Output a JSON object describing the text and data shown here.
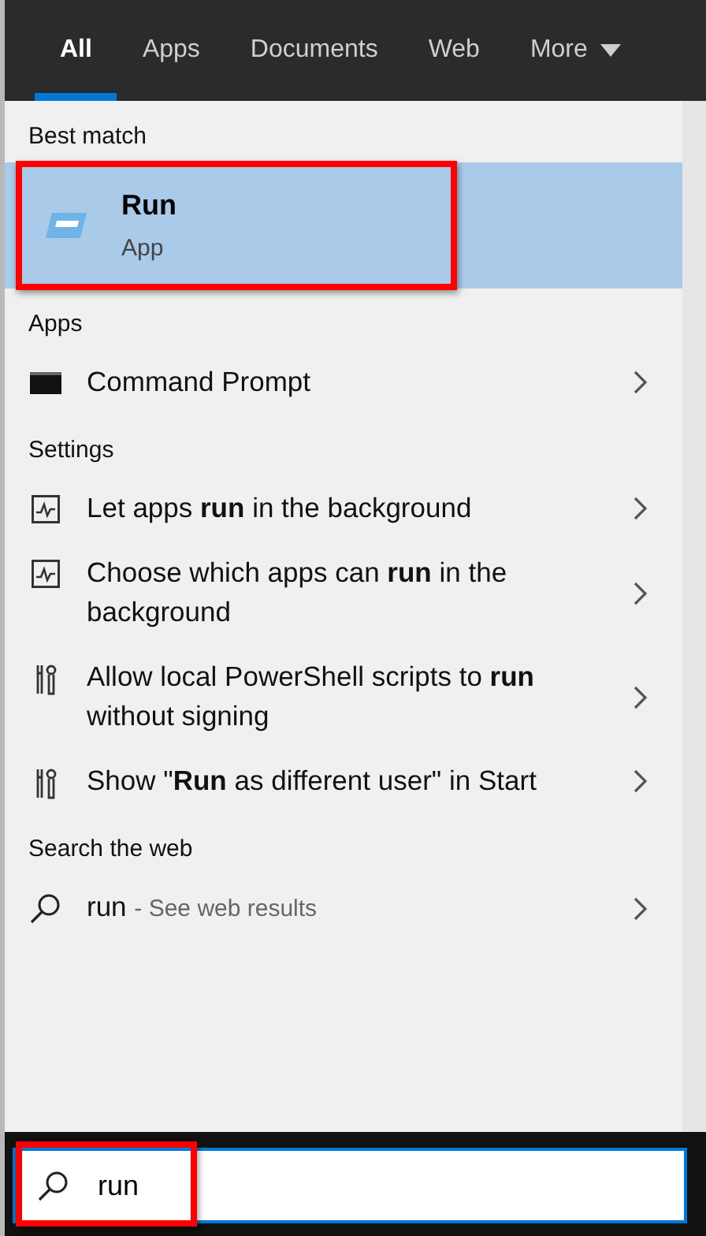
{
  "tabs": [
    {
      "label": "All",
      "selected": true
    },
    {
      "label": "Apps",
      "selected": false
    },
    {
      "label": "Documents",
      "selected": false
    },
    {
      "label": "Web",
      "selected": false
    },
    {
      "label": "More",
      "selected": false,
      "dropdown": true
    }
  ],
  "best_match": {
    "heading": "Best match",
    "title": "Run",
    "subtitle": "App",
    "selected": true,
    "highlighted": true
  },
  "sections": [
    {
      "heading": "Apps",
      "items": [
        {
          "kind": "console",
          "label": "Command Prompt"
        }
      ]
    },
    {
      "heading": "Settings",
      "items": [
        {
          "kind": "activity",
          "label": "Let apps **run** in the background"
        },
        {
          "kind": "activity",
          "label": "Choose which apps can **run** in the background"
        },
        {
          "kind": "tools",
          "label": "Allow local PowerShell scripts to **run** without signing"
        },
        {
          "kind": "tools",
          "label": "Show \"**Run** as different user\" in Start"
        }
      ]
    },
    {
      "heading": "Search the web",
      "items": [
        {
          "kind": "web",
          "label": "run",
          "hint": "- See web results"
        }
      ]
    }
  ],
  "search": {
    "value": "run",
    "highlighted": true
  }
}
